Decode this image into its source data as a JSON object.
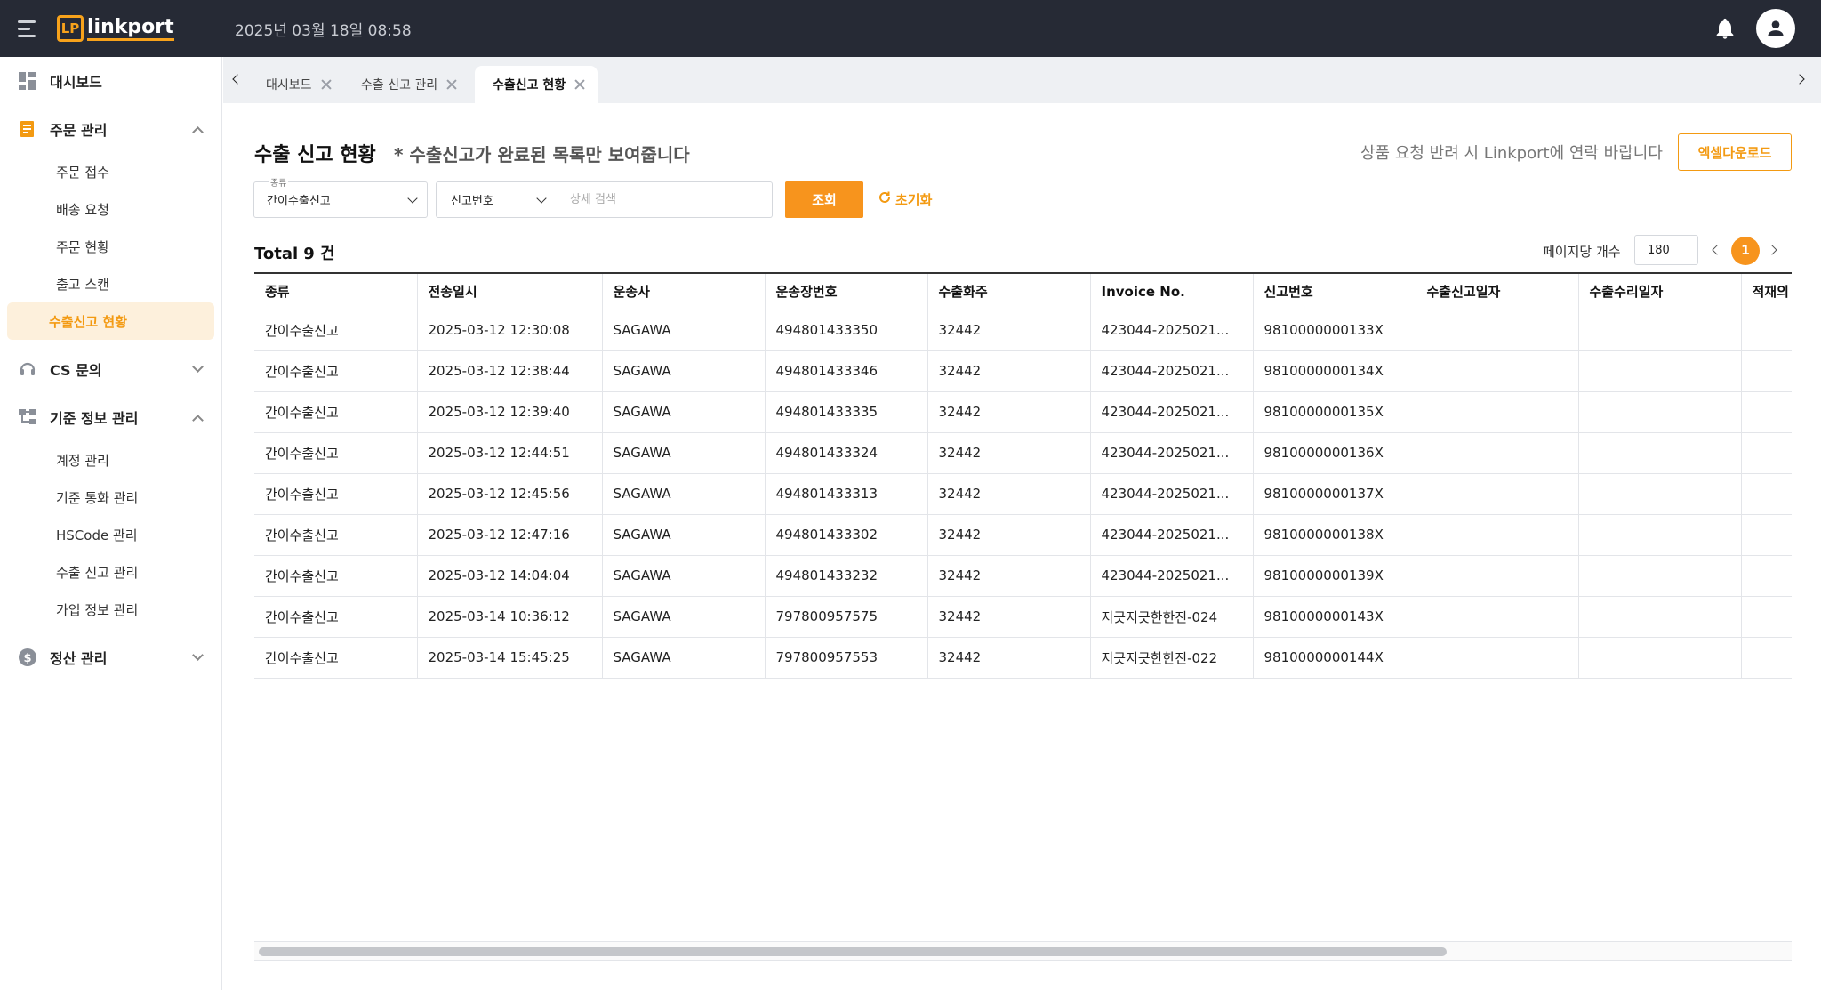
{
  "header": {
    "logo_mark": "LP",
    "logo_text": "linkport",
    "datetime": "2025년 03월 18일 08:58",
    "icons": [
      "menu-toggle-icon",
      "bell-icon",
      "user-icon"
    ]
  },
  "sidebar": {
    "items": [
      {
        "label": "대시보드",
        "icon": "dashboard-icon"
      },
      {
        "label": "주문 관리",
        "icon": "order-icon",
        "expanded": true,
        "children": [
          "주문 접수",
          "배송 요청",
          "주문 현황",
          "출고 스캔",
          "수출신고 현황"
        ],
        "active_child": "수출신고 현황"
      },
      {
        "label": "CS 문의",
        "icon": "headset-icon",
        "expanded": false
      },
      {
        "label": "기준 정보 관리",
        "icon": "hierarchy-icon",
        "expanded": true,
        "children": [
          "계정 관리",
          "기준 통화 관리",
          "HSCode 관리",
          "수출 신고 관리",
          "가입 정보 관리"
        ]
      },
      {
        "label": "정산 관리",
        "icon": "dollar-icon",
        "expanded": false
      }
    ]
  },
  "tabs": [
    {
      "label": "대시보드",
      "active": false
    },
    {
      "label": "수출 신고 관리",
      "active": false
    },
    {
      "label": "수출신고 현황",
      "active": true
    }
  ],
  "page": {
    "title": "수출 신고 현황",
    "note": "* 수출신고가 완료된 목록만 보여줍니다",
    "contact_note": "상품 요청 반려 시 Linkport에 연락 바랍니다",
    "excel_button": "엑셀다운로드"
  },
  "filters": {
    "type_label": "종류",
    "type_value": "간이수출신고",
    "key_value": "신고번호",
    "search_placeholder": "상세 검색",
    "search_button": "조회",
    "reset_button": "초기화"
  },
  "summary": {
    "total_label": "Total",
    "total_count": "9 건",
    "per_page_label": "페이지당 개수",
    "per_page_value": "180",
    "current_page": "1"
  },
  "table": {
    "columns": [
      "종류",
      "전송일시",
      "운송사",
      "운송장번호",
      "수출화주",
      "Invoice No.",
      "신고번호",
      "수출신고일자",
      "수출수리일자",
      "적재의"
    ],
    "rows": [
      [
        "간이수출신고",
        "2025-03-12 12:30:08",
        "SAGAWA",
        "494801433350",
        "32442",
        "423044-2025021...",
        "9810000000133X",
        "",
        "",
        ""
      ],
      [
        "간이수출신고",
        "2025-03-12 12:38:44",
        "SAGAWA",
        "494801433346",
        "32442",
        "423044-2025021...",
        "9810000000134X",
        "",
        "",
        ""
      ],
      [
        "간이수출신고",
        "2025-03-12 12:39:40",
        "SAGAWA",
        "494801433335",
        "32442",
        "423044-2025021...",
        "9810000000135X",
        "",
        "",
        ""
      ],
      [
        "간이수출신고",
        "2025-03-12 12:44:51",
        "SAGAWA",
        "494801433324",
        "32442",
        "423044-2025021...",
        "9810000000136X",
        "",
        "",
        ""
      ],
      [
        "간이수출신고",
        "2025-03-12 12:45:56",
        "SAGAWA",
        "494801433313",
        "32442",
        "423044-2025021...",
        "9810000000137X",
        "",
        "",
        ""
      ],
      [
        "간이수출신고",
        "2025-03-12 12:47:16",
        "SAGAWA",
        "494801433302",
        "32442",
        "423044-2025021...",
        "9810000000138X",
        "",
        "",
        ""
      ],
      [
        "간이수출신고",
        "2025-03-12 14:04:04",
        "SAGAWA",
        "494801433232",
        "32442",
        "423044-2025021...",
        "9810000000139X",
        "",
        "",
        ""
      ],
      [
        "간이수출신고",
        "2025-03-14 10:36:12",
        "SAGAWA",
        "797800957575",
        "32442",
        "지긋지긋한한진-024",
        "9810000000143X",
        "",
        "",
        ""
      ],
      [
        "간이수출신고",
        "2025-03-14 15:45:25",
        "SAGAWA",
        "797800957553",
        "32442",
        "지긋지긋한한진-022",
        "9810000000144X",
        "",
        "",
        ""
      ]
    ]
  },
  "colors": {
    "accent": "#f7941d",
    "topbar": "#262a35",
    "active_bg": "#fdf0dc"
  }
}
